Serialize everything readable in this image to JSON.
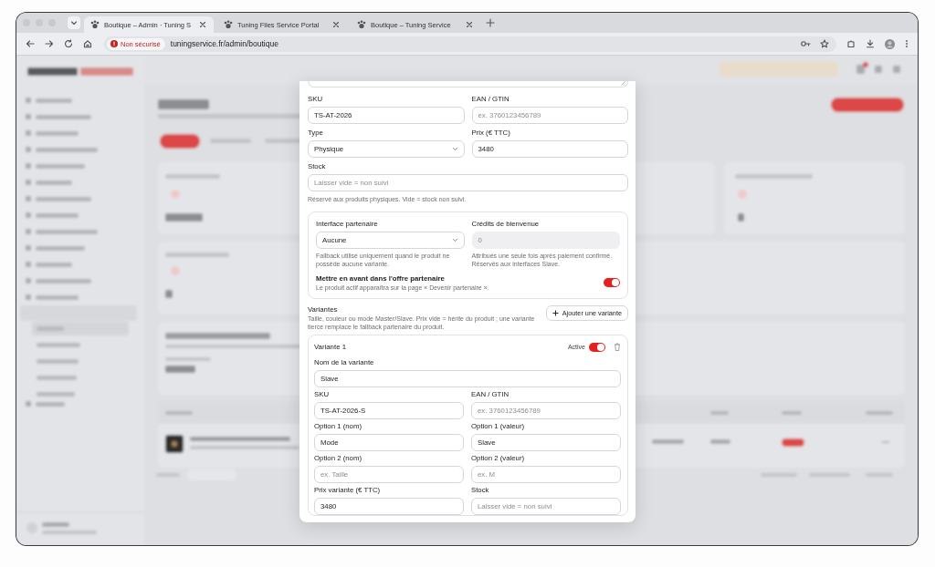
{
  "browser": {
    "tabs": [
      {
        "title": "Boutique – Admin · Tuning S",
        "selected": true
      },
      {
        "title": "Tuning Files Service Portal",
        "selected": false
      },
      {
        "title": "Boutique – Tuning Service",
        "selected": false
      }
    ],
    "security_label": "Non sécurisé",
    "url": "tuningservice.fr/admin/boutique"
  },
  "modal": {
    "product_rows": [
      [
        {
          "label": "SKU",
          "kind": "text",
          "value": "TS-AT-2026"
        },
        {
          "label": "EAN / GTIN",
          "kind": "text",
          "placeholder": "ex. 3760123456789"
        }
      ],
      [
        {
          "label": "Type",
          "kind": "select",
          "value": "Physique"
        },
        {
          "label": "Prix (€ TTC)",
          "kind": "text",
          "value": "3480"
        }
      ],
      [
        {
          "label": "Stock",
          "kind": "text",
          "placeholder": "Laisser vide = non suivi"
        }
      ]
    ],
    "stock_help": "Réservé aux produits physiques. Vide = stock non suivi.",
    "partner": {
      "interface": {
        "label": "Interface partenaire",
        "kind": "select",
        "value": "Aucune"
      },
      "interface_help": "Fallback utilisé uniquement quand le produit ne possède aucune variante.",
      "credits": {
        "label": "Crédits de bienvenue",
        "kind": "text",
        "placeholder": "0",
        "disabled": true
      },
      "credits_help": "Attribués une seule fois après paiement confirmé. Réservés aux interfaces Slave.",
      "feature": {
        "title": "Mettre en avant dans l'offre partenaire",
        "description": "Le produit actif apparaîtra sur la page « Devenir partenaire ».",
        "on": true
      }
    },
    "variants_title": "Variantes",
    "variants_description": "Taille, couleur ou mode Master/Slave. Prix vide = hérite du produit ; une variante tierce remplace le fallback partenaire du produit.",
    "add_variant_button": "Ajouter une variante",
    "variants": [
      {
        "title": "Variante 1",
        "active_label": "Active",
        "active": true,
        "rows": [
          [
            {
              "label": "Nom de la variante",
              "kind": "text",
              "value": "Slave"
            }
          ],
          [
            {
              "label": "SKU",
              "kind": "text",
              "value": "TS-AT-2026-S"
            },
            {
              "label": "EAN / GTIN",
              "kind": "text",
              "placeholder": "ex. 3760123456789"
            }
          ],
          [
            {
              "label": "Option 1 (nom)",
              "kind": "text",
              "value": "Mode"
            },
            {
              "label": "Option 1 (valeur)",
              "kind": "text",
              "value": "Slave"
            }
          ],
          [
            {
              "label": "Option 2 (nom)",
              "kind": "text",
              "placeholder": "ex. Taille"
            },
            {
              "label": "Option 2 (valeur)",
              "kind": "text",
              "placeholder": "ex. M"
            }
          ],
          [
            {
              "label": "Prix variante (€ TTC)",
              "kind": "text",
              "value": "3480"
            },
            {
              "label": "Stock",
              "kind": "text",
              "placeholder": "Laisser vide = non suivi"
            }
          ]
        ]
      }
    ]
  }
}
